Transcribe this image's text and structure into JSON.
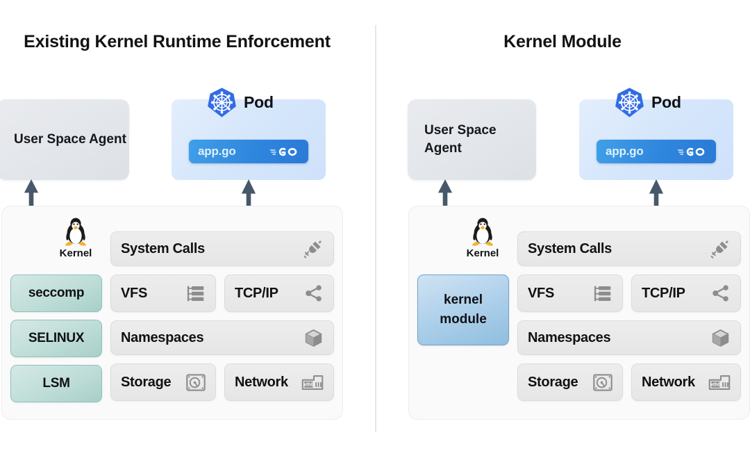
{
  "diagram": {
    "type": "architecture-comparison",
    "panels": [
      {
        "id": "left",
        "title": "Existing Kernel Runtime Enforcement",
        "agent": {
          "label": "User Space Agent",
          "icon": "user-space-agent-box"
        },
        "pod": {
          "label": "Pod",
          "platform_icon": "kubernetes-helm-icon",
          "app": {
            "file": "app.go",
            "lang_icon": "go-gopher-logo-icon"
          }
        },
        "kernel": {
          "label": "Kernel",
          "os_icon": "linux-tux-penguin-icon",
          "security_modules": [
            {
              "label": "seccomp"
            },
            {
              "label": "SELINUX"
            },
            {
              "label": "LSM"
            }
          ],
          "subsystems": [
            {
              "label": "System Calls",
              "icon": "plug-connector-icon"
            },
            {
              "label": "VFS",
              "icon": "file-tree-icon"
            },
            {
              "label": "TCP/IP",
              "icon": "share-network-icon"
            },
            {
              "label": "Namespaces",
              "icon": "cube-3d-icon"
            },
            {
              "label": "Storage",
              "icon": "hard-disk-icon"
            },
            {
              "label": "Network",
              "icon": "eth0-nic-card-icon"
            }
          ]
        },
        "arrows": [
          {
            "name": "agent-to-security-arrow",
            "direction": "bidirectional"
          },
          {
            "name": "pod-to-tcpip-arrow",
            "direction": "bidirectional"
          }
        ]
      },
      {
        "id": "right",
        "title": "Kernel Module",
        "agent": {
          "label": "User Space Agent",
          "icon": "user-space-agent-box"
        },
        "pod": {
          "label": "Pod",
          "platform_icon": "kubernetes-helm-icon",
          "app": {
            "file": "app.go",
            "lang_icon": "go-gopher-logo-icon"
          }
        },
        "kernel": {
          "label": "Kernel",
          "os_icon": "linux-tux-penguin-icon",
          "module": {
            "line1": "kernel",
            "line2": "module"
          },
          "subsystems": [
            {
              "label": "System Calls",
              "icon": "plug-connector-icon"
            },
            {
              "label": "VFS",
              "icon": "file-tree-icon"
            },
            {
              "label": "TCP/IP",
              "icon": "share-network-icon"
            },
            {
              "label": "Namespaces",
              "icon": "cube-3d-icon"
            },
            {
              "label": "Storage",
              "icon": "hard-disk-icon"
            },
            {
              "label": "Network",
              "icon": "eth0-nic-card-icon"
            }
          ]
        },
        "arrows": [
          {
            "name": "agent-to-module-arrow",
            "direction": "bidirectional"
          },
          {
            "name": "pod-to-tcpip-arrow",
            "direction": "bidirectional"
          }
        ]
      }
    ],
    "colors": {
      "background": "#ffffff",
      "title_text": "#111214",
      "agent_box": "#e4e7eb",
      "pod_box": "#d5e6fb",
      "app_chip": "#2f86dd",
      "security_box": "#bfddd8",
      "security_border": "#8fc2bb",
      "module_box": "#aed0ea",
      "module_border": "#6fa3c9",
      "kernel_panel": "#fafafa",
      "subsystem_box": "#e8e8e8",
      "icon_gray": "#8d8d8d",
      "arrow": "#47586b",
      "divider": "#e6e6e6",
      "kubernetes_blue": "#326ce5"
    }
  }
}
